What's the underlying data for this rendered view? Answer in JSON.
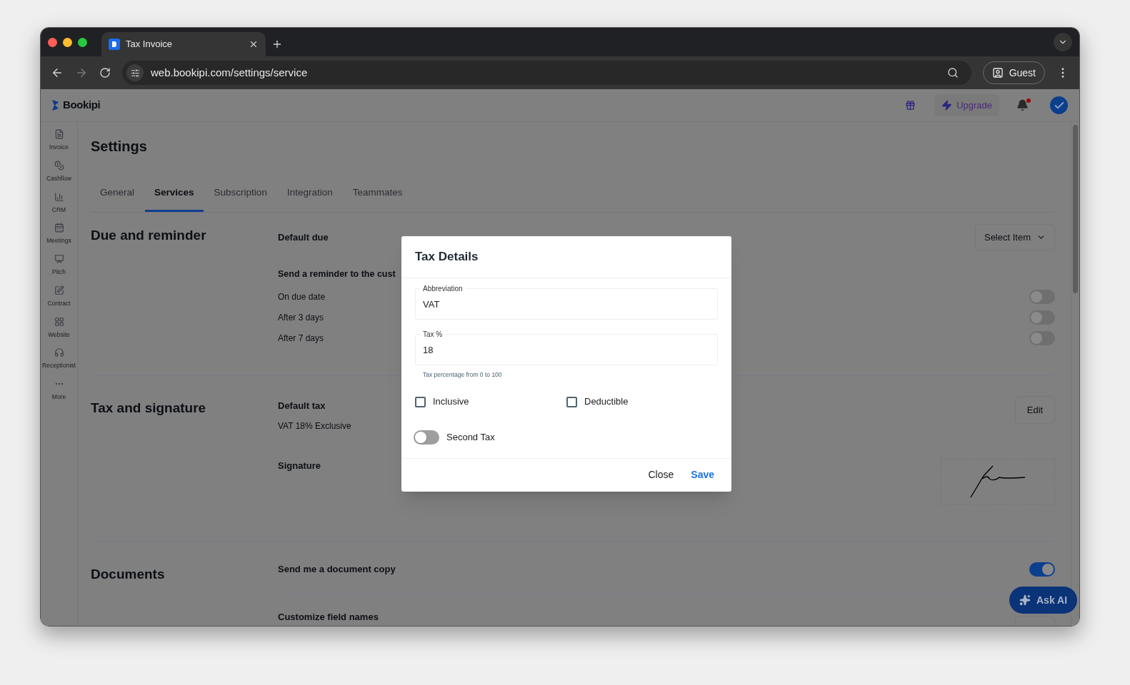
{
  "browser": {
    "tab_title": "Tax Invoice",
    "url": "web.bookipi.com/settings/service",
    "profile": "Guest"
  },
  "header": {
    "brand": "Bookipi",
    "upgrade": "Upgrade",
    "has_notification": true
  },
  "sidebar": {
    "items": [
      {
        "label": "Invoice",
        "kind": "invoice"
      },
      {
        "label": "Cashflow",
        "kind": "cashflow"
      },
      {
        "label": "CRM",
        "kind": "crm"
      },
      {
        "label": "Meetings",
        "kind": "meetings"
      },
      {
        "label": "Pitch",
        "kind": "pitch"
      },
      {
        "label": "Contract",
        "kind": "contract"
      },
      {
        "label": "Website",
        "kind": "website"
      },
      {
        "label": "Receptionist",
        "kind": "receptionist"
      },
      {
        "label": "More",
        "kind": "more"
      }
    ]
  },
  "page": {
    "title": "Settings",
    "tabs": [
      {
        "label": "General",
        "selected": false
      },
      {
        "label": "Services",
        "selected": true
      },
      {
        "label": "Subscription",
        "selected": false
      },
      {
        "label": "Integration",
        "selected": false
      },
      {
        "label": "Teammates",
        "selected": false
      }
    ],
    "due": {
      "title": "Due and reminder",
      "default_due_label": "Default due",
      "select": "Select Item",
      "reminder_label": "Send a reminder to the cust",
      "reminders": [
        {
          "label": "On due date",
          "on": false
        },
        {
          "label": "After 3 days",
          "on": false
        },
        {
          "label": "After 7 days",
          "on": false
        }
      ]
    },
    "tax": {
      "title": "Tax and signature",
      "default_tax_label": "Default tax",
      "default_tax_value": "VAT 18% Exclusive",
      "edit": "Edit",
      "signature_label": "Signature"
    },
    "documents": {
      "title": "Documents",
      "copy_label": "Send me a document copy",
      "copy_on": true,
      "customize_label": "Customize field names"
    },
    "ask_ai": "Ask AI"
  },
  "dialog": {
    "title": "Tax Details",
    "fields": [
      {
        "label": "Abbreviation",
        "value": "VAT"
      },
      {
        "label": "Tax %",
        "value": "18",
        "hint": "Tax percentage from 0 to 100"
      }
    ],
    "checkboxes": [
      {
        "label": "Inclusive",
        "checked": false
      },
      {
        "label": "Deductible",
        "checked": false
      }
    ],
    "second_tax": {
      "label": "Second Tax",
      "on": false
    },
    "buttons": [
      {
        "label": "Close",
        "kind": "secondary"
      },
      {
        "label": "Save",
        "kind": "primary"
      }
    ]
  }
}
